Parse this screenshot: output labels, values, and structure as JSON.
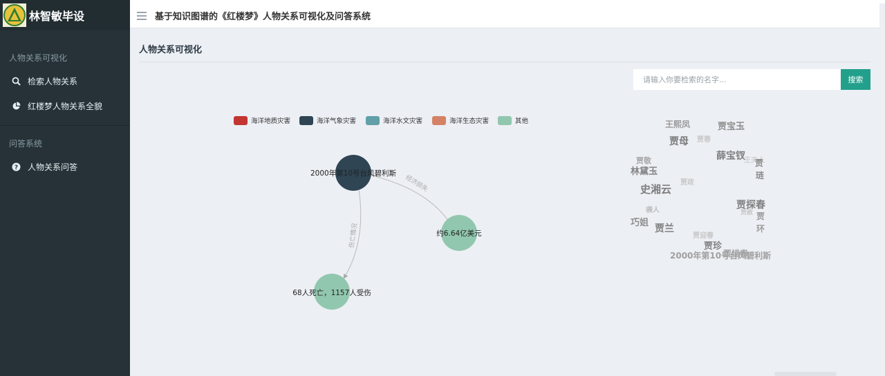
{
  "app": {
    "brand": "林智敏毕设"
  },
  "header": {
    "title": "基于知识图谱的《红楼梦》人物关系可视化及问答系统"
  },
  "sidebar": {
    "sections": [
      {
        "title": "人物关系可视化",
        "items": [
          {
            "label": "检索人物关系",
            "icon": "search-icon"
          },
          {
            "label": "红楼梦人物关系全貌",
            "icon": "pie-chart-icon"
          }
        ]
      },
      {
        "title": "问答系统",
        "items": [
          {
            "label": "人物关系问答",
            "icon": "question-circle-icon"
          }
        ]
      }
    ]
  },
  "main": {
    "page_title": "人物关系可视化"
  },
  "search": {
    "placeholder": "请输入你要检索的名字...",
    "button_label": "搜索"
  },
  "graph": {
    "legend": [
      {
        "label": "海洋地质灾害",
        "color": "#c23531"
      },
      {
        "label": "海洋气象灾害",
        "color": "#2f4554"
      },
      {
        "label": "海洋水文灾害",
        "color": "#61a0a8"
      },
      {
        "label": "海洋生态灾害",
        "color": "#d48265"
      },
      {
        "label": "其他",
        "color": "#91c7ae"
      }
    ],
    "nodes": [
      {
        "label": "2000年第10号台风碧利斯",
        "color": "#2f4554"
      },
      {
        "label": "约6.64亿美元",
        "color": "#91c7ae"
      },
      {
        "label": "68人死亡，1157人受伤",
        "color": "#91c7ae"
      }
    ],
    "edges": [
      {
        "label": "经济损失"
      },
      {
        "label": "伤亡情况"
      }
    ]
  },
  "word_cloud": [
    {
      "text": "王熙凤",
      "color": "#9a9a9a"
    },
    {
      "text": "贾宝玉",
      "color": "#8f8f8f"
    },
    {
      "text": "贾母",
      "color": "#7a7a7a"
    },
    {
      "text": "贾蓉",
      "color": "#c8c8c8"
    },
    {
      "text": "薛宝钗",
      "color": "#808080"
    },
    {
      "text": "贾敬",
      "color": "#a8a8a8"
    },
    {
      "text": "王夫人",
      "color": "#d0d0d0"
    },
    {
      "text": "贾",
      "color": "#8a8a8a"
    },
    {
      "text": "林黛玉",
      "color": "#858585"
    },
    {
      "text": "琏",
      "color": "#8a8a8a"
    },
    {
      "text": "史湘云",
      "color": "#7d7d7d"
    },
    {
      "text": "贾政",
      "color": "#c8c8c8"
    },
    {
      "text": "贾探春",
      "color": "#808080"
    },
    {
      "text": "袭人",
      "color": "#bdbdbd"
    },
    {
      "text": "贾赦",
      "color": "#c8c8c8"
    },
    {
      "text": "贾",
      "color": "#9a9a9a"
    },
    {
      "text": "巧姐",
      "color": "#8f8f8f"
    },
    {
      "text": "贾兰",
      "color": "#7f7f7f"
    },
    {
      "text": "环",
      "color": "#9a9a9a"
    },
    {
      "text": "贾迎春",
      "color": "#c8c8c8"
    },
    {
      "text": "贾珍",
      "color": "#808080"
    },
    {
      "text": "贾惜春",
      "color": "#a5a5a5"
    },
    {
      "text": "2000年第10号台风碧利斯",
      "color": "#a0a0a0"
    }
  ]
}
